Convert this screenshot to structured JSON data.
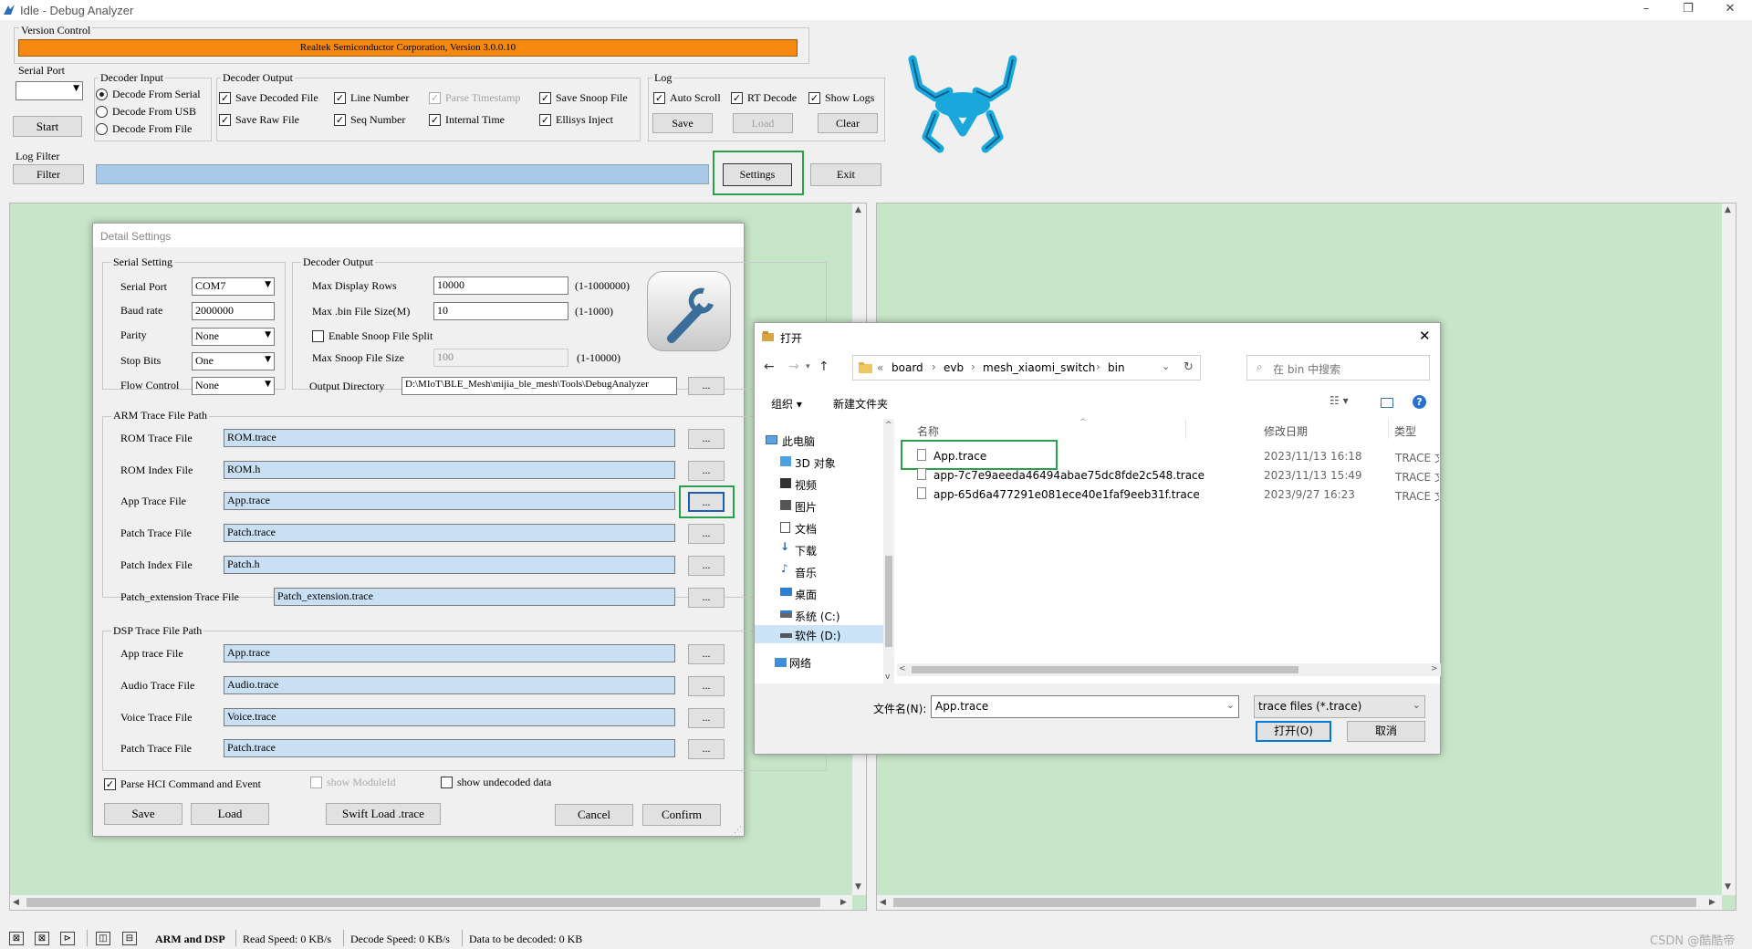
{
  "window": {
    "title": "Idle - Debug Analyzer",
    "min": "–",
    "max": "❐",
    "close": "✕"
  },
  "version": {
    "group": "Version Control",
    "text": "Realtek Semiconductor Corporation, Version 3.0.0.10",
    "bar_color": "#f5890f"
  },
  "serial_port": {
    "group": "Serial Port",
    "value": "",
    "start": "Start"
  },
  "decoder_input": {
    "group": "Decoder Input",
    "options": [
      "Decode From Serial",
      "Decode From USB",
      "Decode From File"
    ],
    "selected": "Decode From Serial"
  },
  "decoder_output": {
    "group": "Decoder Output",
    "items": [
      {
        "label": "Save Decoded File",
        "checked": true,
        "enabled": true
      },
      {
        "label": "Line Number",
        "checked": true,
        "enabled": true
      },
      {
        "label": "Parse Timestamp",
        "checked": true,
        "enabled": false
      },
      {
        "label": "Save Snoop File",
        "checked": true,
        "enabled": true
      },
      {
        "label": "Save Raw File",
        "checked": true,
        "enabled": true
      },
      {
        "label": "Seq Number",
        "checked": true,
        "enabled": true
      },
      {
        "label": "Internal Time",
        "checked": true,
        "enabled": true
      },
      {
        "label": "Ellisys Inject",
        "checked": true,
        "enabled": true
      }
    ]
  },
  "log": {
    "group": "Log",
    "auto_scroll": "Auto Scroll",
    "rt_decode": "RT Decode",
    "show_logs": "Show Logs",
    "save": "Save",
    "load": "Load",
    "clear": "Clear"
  },
  "log_filter": {
    "group": "Log Filter",
    "filter": "Filter",
    "value": "",
    "settings": "Settings",
    "exit": "Exit"
  },
  "logo": {
    "color": "#1aa8dc",
    "name": "realtek-crab-logo"
  },
  "detail": {
    "title": "Detail Settings",
    "serial": {
      "group": "Serial Setting",
      "rows": [
        {
          "label": "Serial Port",
          "value": "COM7",
          "type": "combo"
        },
        {
          "label": "Baud rate",
          "value": "2000000",
          "type": "input"
        },
        {
          "label": "Parity",
          "value": "None",
          "type": "combo"
        },
        {
          "label": "Stop Bits",
          "value": "One",
          "type": "combo"
        },
        {
          "label": "Flow Control",
          "value": "None",
          "type": "combo"
        }
      ]
    },
    "output": {
      "group": "Decoder Output",
      "max_rows_label": "Max Display Rows",
      "max_rows": "10000",
      "max_rows_range": "(1-1000000)",
      "max_bin_label": "Max .bin File Size(M)",
      "max_bin": "10",
      "max_bin_range": "(1-1000)",
      "snoop_split": "Enable Snoop File Split",
      "max_snoop_label": "Max Snoop File Size",
      "max_snoop": "100",
      "max_snoop_range": "(1-10000)",
      "dir_label": "Output Directory",
      "dir": "D:\\MIoT\\BLE_Mesh\\mijia_ble_mesh\\Tools\\DebugAnalyzer"
    },
    "arm": {
      "group": "ARM Trace File Path",
      "rows": [
        {
          "label": "ROM Trace File",
          "value": "ROM.trace"
        },
        {
          "label": "ROM Index File",
          "value": "ROM.h"
        },
        {
          "label": "App Trace File",
          "value": "App.trace"
        },
        {
          "label": "Patch Trace File",
          "value": "Patch.trace"
        },
        {
          "label": "Patch Index File",
          "value": "Patch.h"
        },
        {
          "label": "Patch_extension Trace File",
          "value": "Patch_extension.trace"
        }
      ]
    },
    "dsp": {
      "group": "DSP Trace File Path",
      "rows": [
        {
          "label": "App trace File",
          "value": "App.trace"
        },
        {
          "label": "Audio Trace File",
          "value": "Audio.trace"
        },
        {
          "label": "Voice Trace File",
          "value": "Voice.trace"
        },
        {
          "label": "Patch Trace File",
          "value": "Patch.trace"
        }
      ]
    },
    "browse": "...",
    "parse_hci": "Parse HCI Command and Event",
    "show_module": "show ModuleId",
    "show_undecoded": "show undecoded data",
    "save": "Save",
    "load": "Load",
    "swift": "Swift Load .trace",
    "cancel": "Cancel",
    "confirm": "Confirm"
  },
  "open_dialog": {
    "title": "打开",
    "breadcrumb": [
      "«",
      "board",
      "evb",
      "mesh_xiaomi_switch",
      "bin"
    ],
    "search_placeholder": "在 bin 中搜索",
    "organize": "组织 ▾",
    "new_folder": "新建文件夹",
    "nav": [
      "此电脑",
      "3D 对象",
      "视频",
      "图片",
      "文档",
      "下载",
      "音乐",
      "桌面",
      "系统 (C:)",
      "软件 (D:)",
      "网络"
    ],
    "columns": {
      "name": "名称",
      "date": "修改日期",
      "type": "类型"
    },
    "files": [
      {
        "name": "App.trace",
        "date": "2023/11/13 16:18",
        "type": "TRACE 文"
      },
      {
        "name": "app-7c7e9aeeda46494abae75dc8fde2c548.trace",
        "date": "2023/11/13 15:49",
        "type": "TRACE 文"
      },
      {
        "name": "app-65d6a477291e081ece40e1faf9eeb31f.trace",
        "date": "2023/9/27 16:23",
        "type": "TRACE 文"
      }
    ],
    "filename_label": "文件名(N):",
    "filename": "App.trace",
    "filter": "trace files (*.trace)",
    "open": "打开(O)",
    "cancel": "取消"
  },
  "status": {
    "mode": "ARM and DSP",
    "read_speed": "Read Speed:  0 KB/s",
    "decode_speed": "Decode Speed:  0 KB/s",
    "to_decode": "Data to be decoded:  0 KB"
  },
  "watermark": "CSDN @酷酷帝"
}
